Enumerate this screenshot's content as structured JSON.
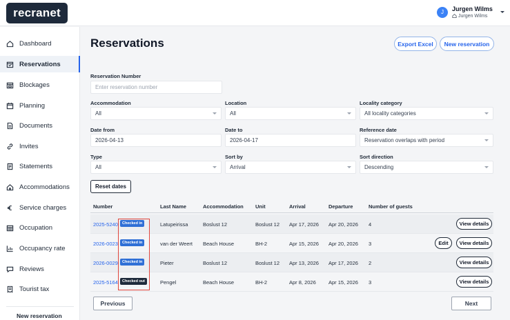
{
  "app": {
    "logo_text": "recranet"
  },
  "user": {
    "initial": "J",
    "name": "Jurgen Wilms",
    "account": "Jurgen Wilms"
  },
  "sidebar": {
    "items": [
      {
        "label": "Dashboard",
        "icon": "home-icon"
      },
      {
        "label": "Reservations",
        "icon": "calendar-check-icon",
        "active": true
      },
      {
        "label": "Blockages",
        "icon": "calendar-block-icon"
      },
      {
        "label": "Planning",
        "icon": "calendar-icon"
      },
      {
        "label": "Documents",
        "icon": "document-icon"
      },
      {
        "label": "Invites",
        "icon": "link-icon"
      },
      {
        "label": "Statements",
        "icon": "statement-icon"
      },
      {
        "label": "Accommodations",
        "icon": "house-icon"
      },
      {
        "label": "Service charges",
        "icon": "euro-icon"
      },
      {
        "label": "Occupation",
        "icon": "calendar-grid-icon"
      },
      {
        "label": "Occupancy rate",
        "icon": "bar-chart-icon"
      },
      {
        "label": "Reviews",
        "icon": "chat-icon"
      },
      {
        "label": "Tourist tax",
        "icon": "receipt-icon"
      }
    ],
    "new_reservation": "New reservation"
  },
  "page": {
    "title": "Reservations",
    "export_button": "Export Excel",
    "new_button": "New reservation"
  },
  "filters": {
    "reservation_number": {
      "label": "Reservation Number",
      "placeholder": "Enter reservation number"
    },
    "accommodation": {
      "label": "Accommodation",
      "value": "All"
    },
    "location": {
      "label": "Location",
      "value": "All"
    },
    "locality_category": {
      "label": "Locality category",
      "value": "All locality categories"
    },
    "date_from": {
      "label": "Date from",
      "value": "2026-04-13"
    },
    "date_to": {
      "label": "Date to",
      "value": "2026-04-17"
    },
    "reference_date": {
      "label": "Reference date",
      "value": "Reservation overlaps with period"
    },
    "type": {
      "label": "Type",
      "value": "All"
    },
    "sort_by": {
      "label": "Sort by",
      "value": "Arrival"
    },
    "sort_direction": {
      "label": "Sort direction",
      "value": "Descending"
    },
    "reset_button": "Reset dates"
  },
  "table": {
    "columns": [
      "Number",
      "Last Name",
      "Accommodation",
      "Unit",
      "Arrival",
      "Departure",
      "Number of guests"
    ],
    "rows": [
      {
        "number": "2025-5240",
        "status": "Checked in",
        "last_name": "Latupeirissa",
        "accommodation": "Boslust 12",
        "unit": "Boslust 12",
        "arrival": "Apr 17, 2026",
        "departure": "Apr 20, 2026",
        "guests": "4",
        "edit": "",
        "details": "View details"
      },
      {
        "number": "2026-0023",
        "status": "Checked in",
        "last_name": "van der Weert",
        "accommodation": "Beach House",
        "unit": "BH-2",
        "arrival": "Apr 15, 2026",
        "departure": "Apr 20, 2026",
        "guests": "3",
        "edit": "Edit",
        "details": "View details"
      },
      {
        "number": "2026-0029",
        "status": "Checked in",
        "last_name": "Pieter",
        "accommodation": "Boslust 12",
        "unit": "Boslust 12",
        "arrival": "Apr 13, 2026",
        "departure": "Apr 17, 2026",
        "guests": "2",
        "edit": "",
        "details": "View details"
      },
      {
        "number": "2025-5164",
        "status": "Checked out",
        "last_name": "Pengel",
        "accommodation": "Beach House",
        "unit": "BH-2",
        "arrival": "Apr 8, 2026",
        "departure": "Apr 15, 2026",
        "guests": "3",
        "edit": "",
        "details": "View details"
      }
    ]
  },
  "pagination": {
    "previous": "Previous",
    "next": "Next"
  },
  "colors": {
    "accent": "#2563eb",
    "brand_dark": "#1e2a3b",
    "checked_in": "#2f6fd6",
    "checked_out": "#1e2a3b",
    "highlight": "#e0443a"
  }
}
